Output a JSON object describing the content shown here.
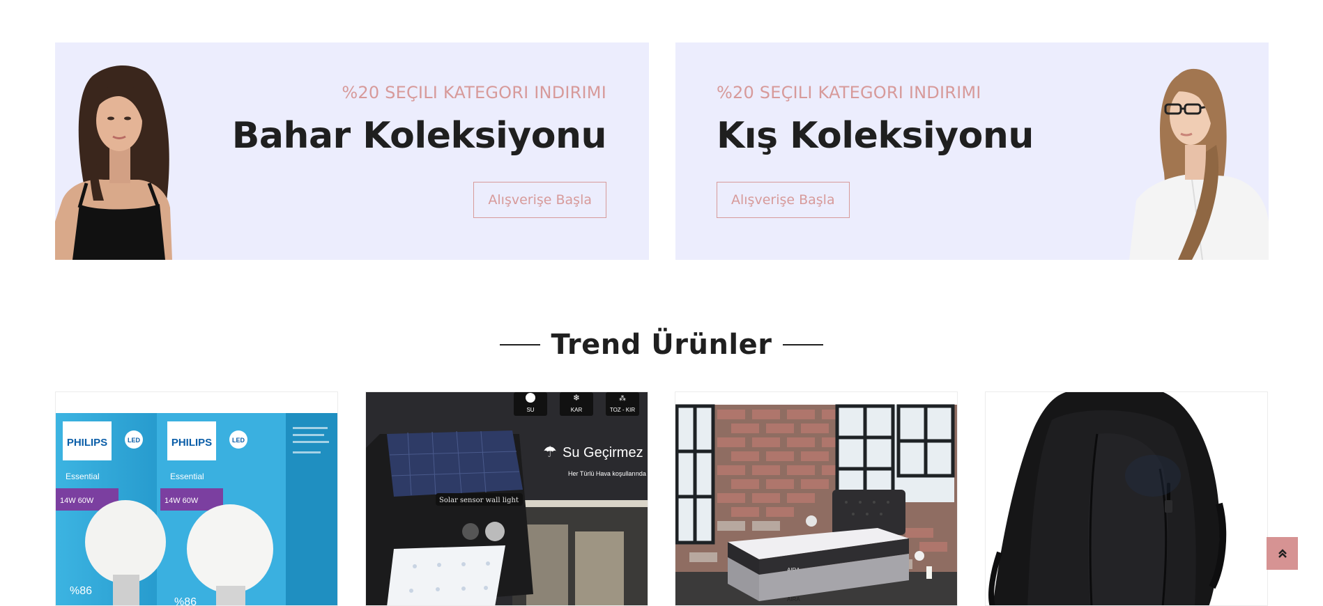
{
  "banners": [
    {
      "subtitle": "%20 SEÇILI KATEGORI INDIRIMI",
      "title": "Bahar Koleksiyonu",
      "button_label": "Alışverişe Başla"
    },
    {
      "subtitle": "%20 SEÇILI KATEGORI INDIRIMI",
      "title": "Kış Koleksiyonu",
      "button_label": "Alışverişe Başla"
    }
  ],
  "section": {
    "title": "Trend Ürünler"
  },
  "products": [
    {
      "image": "philips-led-bulb-boxes",
      "brand_text": "PHILIPS",
      "sub_text": "Essential",
      "badge": "LED",
      "watt_text": "14W 60W",
      "percent_text": "%86"
    },
    {
      "image": "solar-wall-light",
      "device_label": "Solar sensor wall light",
      "water_text": "Su Geçirmez",
      "water_sub": "Her Türlü Hava koşullarında Şekilde Çalışır..",
      "weather_icons": [
        "SU",
        "KAR",
        "TOZ - KIR"
      ]
    },
    {
      "image": "single-bed-mattress",
      "mattress_brand": "AIRA"
    },
    {
      "image": "black-backpack"
    }
  ],
  "colors": {
    "banner_bg": "#ecedfd",
    "accent": "#d79a9a",
    "heading": "#1f1f1f",
    "scroll_button": "#d69393"
  },
  "scroll_top": {
    "icon": "double-chevron-up-icon"
  }
}
